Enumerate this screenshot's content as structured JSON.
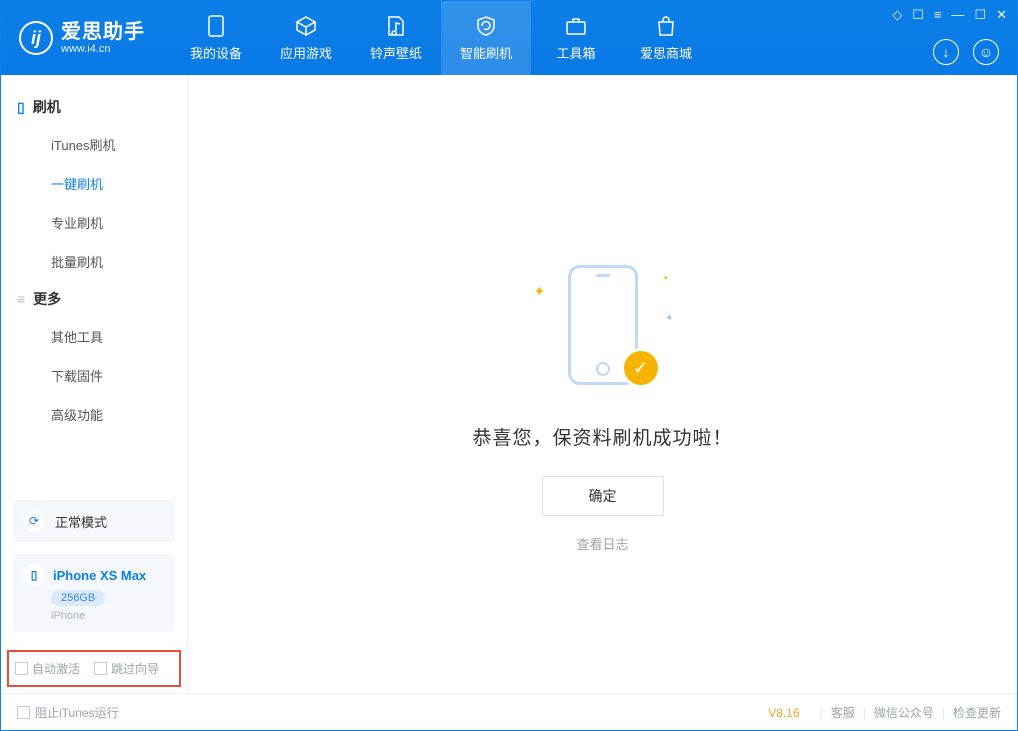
{
  "app": {
    "name": "爱思助手",
    "url": "www.i4.cn"
  },
  "nav": {
    "tabs": [
      {
        "label": "我的设备"
      },
      {
        "label": "应用游戏"
      },
      {
        "label": "铃声壁纸"
      },
      {
        "label": "智能刷机"
      },
      {
        "label": "工具箱"
      },
      {
        "label": "爱思商城"
      }
    ],
    "active_index": 3
  },
  "sidebar": {
    "groups": [
      {
        "title": "刷机",
        "items": [
          "iTunes刷机",
          "一键刷机",
          "专业刷机",
          "批量刷机"
        ],
        "active_index": 1
      },
      {
        "title": "更多",
        "items": [
          "其他工具",
          "下载固件",
          "高级功能"
        ],
        "active_index": -1
      }
    ],
    "mode": "正常模式",
    "device": {
      "name": "iPhone XS Max",
      "storage": "256GB",
      "type": "iPhone"
    },
    "options": {
      "auto_activate": "自动激活",
      "skip_guide": "跳过向导"
    }
  },
  "main": {
    "success_text": "恭喜您，保资料刷机成功啦！",
    "ok_button": "确定",
    "view_log": "查看日志"
  },
  "footer": {
    "block_itunes": "阻止iTunes运行",
    "version": "V8.16",
    "links": [
      "客服",
      "微信公众号",
      "检查更新"
    ]
  }
}
